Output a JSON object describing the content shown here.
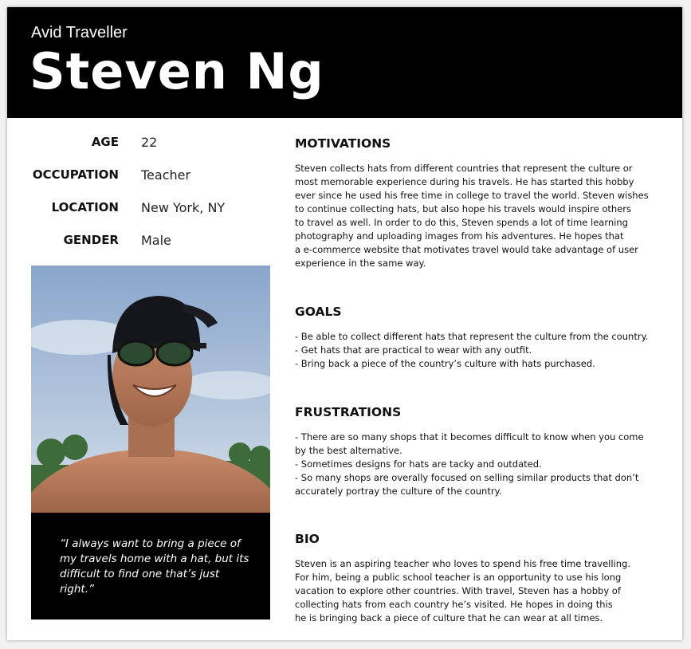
{
  "header": {
    "subtitle": "Avid Traveller",
    "name": "Steven Ng"
  },
  "facts": [
    {
      "label": "AGE",
      "value": "22"
    },
    {
      "label": "OCCUPATION",
      "value": "Teacher"
    },
    {
      "label": "LOCATION",
      "value": "New York, NY"
    },
    {
      "label": "GENDER",
      "value": "Male"
    }
  ],
  "quote": "“I always want to bring a piece of my travels home with a hat, but its difficult to find one that’s just right.”",
  "sections": {
    "motivations": {
      "title": "MOTIVATIONS",
      "lines": [
        "Steven collects hats from different countries that represent the culture or",
        "most memorable experience during his travels. He has started this hobby",
        "ever since he used his free time in college to travel the world. Steven wishes",
        "to continue collecting hats, but also hope his travels would inspire others",
        "to travel as well. In order to do this, Steven spends a lot of time learning",
        "photography and uploading images from his adventures. He hopes that",
        "a e-commerce website that motivates travel would take advantage of user",
        "experience in the same way."
      ]
    },
    "goals": {
      "title": "GOALS",
      "lines": [
        "- Be able to collect different hats that represent the culture from the country.",
        "- Get hats that are practical to wear with any outfit.",
        "- Bring back a piece of the country’s culture with hats purchased."
      ]
    },
    "frustrations": {
      "title": "FRUSTRATIONS",
      "lines": [
        "- There are so many shops that it becomes difficult to know when you come",
        "by the best alternative.",
        "- Sometimes designs for hats are tacky and outdated.",
        "- So many shops are overally focused on selling similar products that don’t",
        "accurately portray the culture of the country."
      ]
    },
    "bio": {
      "title": "BIO",
      "lines": [
        "Steven is an aspiring teacher who loves to spend his free time travelling.",
        "For him, being a public school teacher is an opportunity to use his long",
        "vacation to explore other countries. With travel, Steven has a hobby of",
        "collecting hats from each country he’s visited. He hopes in doing this",
        "he is bringing back a piece of culture that he can wear at all times."
      ]
    }
  },
  "colors": {
    "header_bg": "#000000",
    "sky": "#9fb6d4",
    "skin": "#b2785c"
  }
}
